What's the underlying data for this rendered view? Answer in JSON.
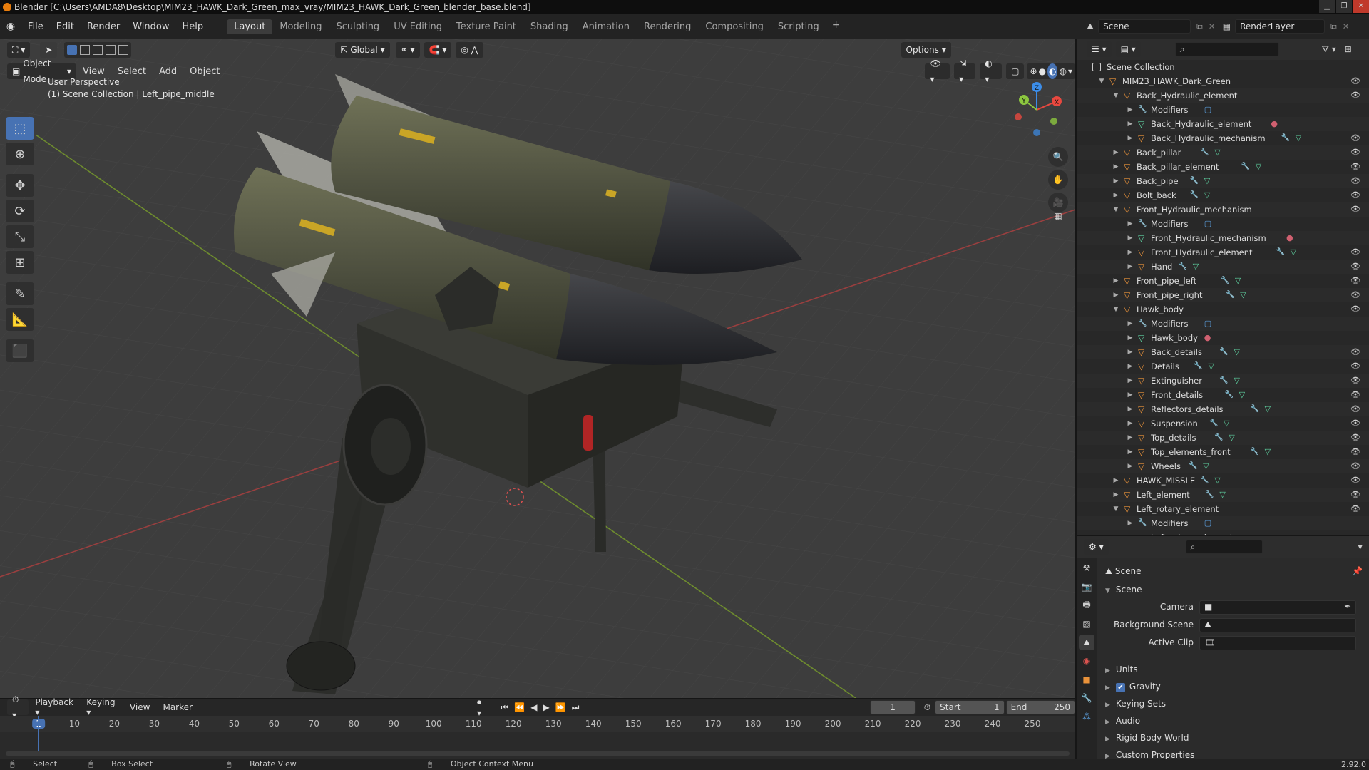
{
  "window": {
    "title": "Blender [C:\\Users\\AMDA8\\Desktop\\MIM23_HAWK_Dark_Green_max_vray/MIM23_HAWK_Dark_Green_blender_base.blend]"
  },
  "menu": [
    "File",
    "Edit",
    "Render",
    "Window",
    "Help"
  ],
  "workspaces": [
    "Layout",
    "Modeling",
    "Sculpting",
    "UV Editing",
    "Texture Paint",
    "Shading",
    "Animation",
    "Rendering",
    "Compositing",
    "Scripting"
  ],
  "workspace_active": "Layout",
  "scene_selector": {
    "scene": "Scene",
    "render_layer": "RenderLayer"
  },
  "viewport_header": {
    "transform_orientation": "Global",
    "options_label": "Options",
    "mode": "Object Mode",
    "menus": [
      "View",
      "Select",
      "Add",
      "Object"
    ]
  },
  "viewport": {
    "perspective_label": "User Perspective",
    "collection_label": "(1) Scene Collection | Left_pipe_middle",
    "axes": {
      "x": "X",
      "y": "Y",
      "z": "Z"
    }
  },
  "timeline": {
    "menus": [
      "Playback",
      "Keying",
      "View",
      "Marker"
    ],
    "current_frame": "1",
    "start_label": "Start",
    "start": "1",
    "end_label": "End",
    "end": "250",
    "ruler": [
      "1",
      "10",
      "20",
      "30",
      "40",
      "50",
      "60",
      "70",
      "80",
      "90",
      "100",
      "110",
      "120",
      "130",
      "140",
      "150",
      "160",
      "170",
      "180",
      "190",
      "200",
      "210",
      "220",
      "230",
      "240",
      "250"
    ]
  },
  "statusbar": {
    "select": "Select",
    "box_select": "Box Select",
    "rotate": "Rotate View",
    "context": "Object Context Menu",
    "version": "2.92.0"
  },
  "outliner": {
    "root": "Scene Collection",
    "rows": [
      {
        "label": "MIM23_HAWK_Dark_Green",
        "type": "object",
        "depth": 1,
        "expanded": true,
        "extras": [],
        "eye": true
      },
      {
        "label": "Back_Hydraulic_element",
        "type": "object",
        "depth": 2,
        "expanded": true,
        "extras": [],
        "eye": true
      },
      {
        "label": "Modifiers",
        "type": "modifier",
        "depth": 3,
        "expanded": false,
        "extras": [
          "modifier-blue"
        ],
        "eye": false
      },
      {
        "label": "Back_Hydraulic_element",
        "type": "mesh",
        "depth": 3,
        "expanded": false,
        "extras": [
          "material"
        ],
        "eye": false
      },
      {
        "label": "Back_Hydraulic_mechanism",
        "type": "object",
        "depth": 3,
        "expanded": false,
        "extras": [
          "wrench",
          "mesh"
        ],
        "eye": true
      },
      {
        "label": "Back_pillar",
        "type": "object",
        "depth": 2,
        "expanded": false,
        "extras": [
          "wrench",
          "mesh"
        ],
        "eye": true
      },
      {
        "label": "Back_pillar_element",
        "type": "object",
        "depth": 2,
        "expanded": false,
        "extras": [
          "wrench",
          "mesh"
        ],
        "eye": true
      },
      {
        "label": "Back_pipe",
        "type": "object",
        "depth": 2,
        "expanded": false,
        "extras": [
          "wrench",
          "mesh"
        ],
        "eye": true
      },
      {
        "label": "Bolt_back",
        "type": "object",
        "depth": 2,
        "expanded": false,
        "extras": [
          "wrench",
          "mesh"
        ],
        "eye": true
      },
      {
        "label": "Front_Hydraulic_mechanism",
        "type": "object",
        "depth": 2,
        "expanded": true,
        "extras": [],
        "eye": true
      },
      {
        "label": "Modifiers",
        "type": "modifier",
        "depth": 3,
        "expanded": false,
        "extras": [
          "modifier-blue"
        ],
        "eye": false
      },
      {
        "label": "Front_Hydraulic_mechanism",
        "type": "mesh",
        "depth": 3,
        "expanded": false,
        "extras": [
          "material"
        ],
        "eye": false
      },
      {
        "label": "Front_Hydraulic_element",
        "type": "object",
        "depth": 3,
        "expanded": false,
        "extras": [
          "wrench",
          "mesh"
        ],
        "eye": true
      },
      {
        "label": "Hand",
        "type": "object",
        "depth": 3,
        "expanded": false,
        "extras": [
          "wrench",
          "mesh"
        ],
        "eye": true
      },
      {
        "label": "Front_pipe_left",
        "type": "object",
        "depth": 2,
        "expanded": false,
        "extras": [
          "wrench",
          "mesh"
        ],
        "eye": true
      },
      {
        "label": "Front_pipe_right",
        "type": "object",
        "depth": 2,
        "expanded": false,
        "extras": [
          "wrench",
          "mesh"
        ],
        "eye": true
      },
      {
        "label": "Hawk_body",
        "type": "object",
        "depth": 2,
        "expanded": true,
        "extras": [],
        "eye": true
      },
      {
        "label": "Modifiers",
        "type": "modifier",
        "depth": 3,
        "expanded": false,
        "extras": [
          "modifier-blue"
        ],
        "eye": false
      },
      {
        "label": "Hawk_body",
        "type": "mesh",
        "depth": 3,
        "expanded": false,
        "extras": [
          "material"
        ],
        "eye": false
      },
      {
        "label": "Back_details",
        "type": "object",
        "depth": 3,
        "expanded": false,
        "extras": [
          "wrench",
          "mesh"
        ],
        "eye": true
      },
      {
        "label": "Details",
        "type": "object",
        "depth": 3,
        "expanded": false,
        "extras": [
          "wrench",
          "mesh"
        ],
        "eye": true
      },
      {
        "label": "Extinguisher",
        "type": "object",
        "depth": 3,
        "expanded": false,
        "extras": [
          "wrench",
          "mesh"
        ],
        "eye": true
      },
      {
        "label": "Front_details",
        "type": "object",
        "depth": 3,
        "expanded": false,
        "extras": [
          "wrench",
          "mesh"
        ],
        "eye": true
      },
      {
        "label": "Reflectors_details",
        "type": "object",
        "depth": 3,
        "expanded": false,
        "extras": [
          "wrench",
          "mesh"
        ],
        "eye": true
      },
      {
        "label": "Suspension",
        "type": "object",
        "depth": 3,
        "expanded": false,
        "extras": [
          "wrench",
          "mesh"
        ],
        "eye": true
      },
      {
        "label": "Top_details",
        "type": "object",
        "depth": 3,
        "expanded": false,
        "extras": [
          "wrench",
          "mesh"
        ],
        "eye": true
      },
      {
        "label": "Top_elements_front",
        "type": "object",
        "depth": 3,
        "expanded": false,
        "extras": [
          "wrench",
          "mesh"
        ],
        "eye": true
      },
      {
        "label": "Wheels",
        "type": "object",
        "depth": 3,
        "expanded": false,
        "extras": [
          "wrench",
          "mesh"
        ],
        "eye": true
      },
      {
        "label": "HAWK_MISSLE",
        "type": "object",
        "depth": 2,
        "expanded": false,
        "extras": [
          "wrench",
          "mesh"
        ],
        "eye": true
      },
      {
        "label": "Left_element",
        "type": "object",
        "depth": 2,
        "expanded": false,
        "extras": [
          "wrench",
          "mesh"
        ],
        "eye": true
      },
      {
        "label": "Left_rotary_element",
        "type": "object",
        "depth": 2,
        "expanded": true,
        "extras": [],
        "eye": true
      },
      {
        "label": "Modifiers",
        "type": "modifier",
        "depth": 3,
        "expanded": false,
        "extras": [
          "modifier-blue"
        ],
        "eye": false
      },
      {
        "label": "Left_rotary_element",
        "type": "mesh",
        "depth": 3,
        "expanded": false,
        "extras": [
          "material"
        ],
        "eye": false
      }
    ]
  },
  "properties": {
    "breadcrumb": "Scene",
    "panel_title": "Scene",
    "fields": [
      {
        "label": "Camera",
        "value": ""
      },
      {
        "label": "Background Scene",
        "value": ""
      },
      {
        "label": "Active Clip",
        "value": ""
      }
    ],
    "sections": [
      {
        "label": "Units",
        "checkbox": false
      },
      {
        "label": "Gravity",
        "checkbox": true
      },
      {
        "label": "Keying Sets",
        "checkbox": false
      },
      {
        "label": "Audio",
        "checkbox": false
      },
      {
        "label": "Rigid Body World",
        "checkbox": false
      },
      {
        "label": "Custom Properties",
        "checkbox": false
      }
    ]
  },
  "colors": {
    "accent": "#4772b3",
    "object_orange": "#e9923a",
    "mesh_green": "#5fd3a2",
    "axis_x": "#e8483f",
    "axis_y": "#8cc63f",
    "axis_z": "#3c8de8"
  }
}
